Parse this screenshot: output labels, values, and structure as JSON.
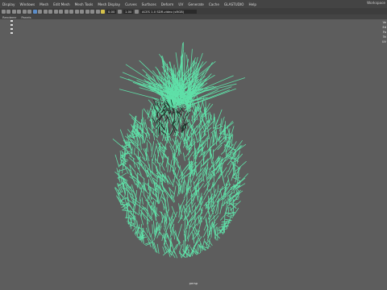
{
  "menubar": {
    "items": [
      "Display",
      "Windows",
      "Mesh",
      "Edit Mesh",
      "Mesh Tools",
      "Mesh Display",
      "Curves",
      "Surfaces",
      "Deform",
      "UV",
      "Generate",
      "Cache",
      "GLASTUDIO",
      "Help"
    ],
    "workspace": "Workspace"
  },
  "toolbar": {
    "field_a": "0.00",
    "field_b": "1.00",
    "color_space": "ACES 1.0 SDR-video (sRGB)"
  },
  "panelbar": {
    "items": [
      "Renderer",
      "Panels"
    ]
  },
  "viewport": {
    "camera_label": "persp",
    "hud_rows": [
      "Ve",
      "Ed",
      "Fa",
      "Tri",
      "UV"
    ],
    "wire_color": "#5fe0a8",
    "background": "#5d5d5d"
  }
}
